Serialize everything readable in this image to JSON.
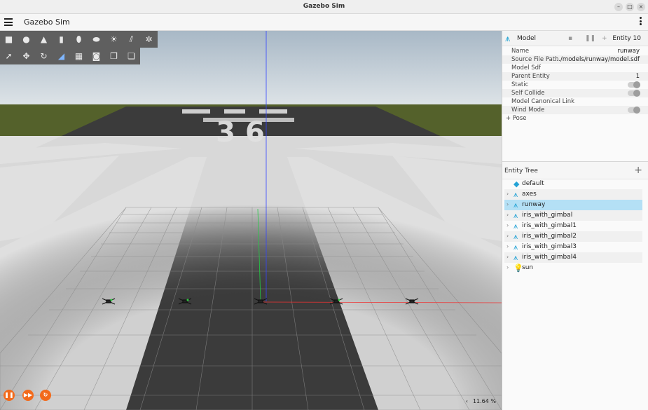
{
  "window": {
    "title": "Gazebo Sim"
  },
  "menubar": {
    "app_title": "Gazebo Sim"
  },
  "toolbar_shapes": [
    "box",
    "sphere",
    "cone",
    "cylinder",
    "capsule",
    "ellipsoid",
    "sun",
    "directional-light",
    "point-light"
  ],
  "toolbar_tools": [
    "select",
    "translate",
    "rotate",
    "snap",
    "screenshot-grid",
    "camera",
    "copy",
    "paste"
  ],
  "component_inspector": {
    "label": "Model",
    "entity": "Entity 10",
    "properties": [
      {
        "key": "Name",
        "value": "runway"
      },
      {
        "key": "Source File Path",
        "value": ".../models/runway/model.sdf"
      },
      {
        "key": "Model Sdf",
        "value": ""
      },
      {
        "key": "Parent Entity",
        "value": "1"
      },
      {
        "key": "Static",
        "toggle": true
      },
      {
        "key": "Self Collide",
        "toggle": true
      },
      {
        "key": "Model Canonical Link",
        "value": ""
      },
      {
        "key": "Wind Mode",
        "toggle": true
      }
    ],
    "pose_label": "Pose"
  },
  "entity_tree": {
    "label": "Entity Tree",
    "items": [
      {
        "name": "default",
        "icon": "world-cube-icon",
        "expandable": false,
        "selected": false
      },
      {
        "name": "axes",
        "icon": "model-icon",
        "expandable": true,
        "selected": false
      },
      {
        "name": "runway",
        "icon": "model-icon",
        "expandable": true,
        "selected": true
      },
      {
        "name": "iris_with_gimbal",
        "icon": "model-icon",
        "expandable": true,
        "selected": false
      },
      {
        "name": "iris_with_gimbal1",
        "icon": "model-icon",
        "expandable": true,
        "selected": false
      },
      {
        "name": "iris_with_gimbal2",
        "icon": "model-icon",
        "expandable": true,
        "selected": false
      },
      {
        "name": "iris_with_gimbal3",
        "icon": "model-icon",
        "expandable": true,
        "selected": false
      },
      {
        "name": "iris_with_gimbal4",
        "icon": "model-icon",
        "expandable": true,
        "selected": false
      },
      {
        "name": "sun",
        "icon": "light-icon",
        "expandable": true,
        "selected": false
      }
    ]
  },
  "scene": {
    "runway_number": "36",
    "real_time_factor": "11.64 %",
    "colors": {
      "sky": "#cfd8de",
      "grass": "#54612b",
      "tarmac": "#3d3d3d",
      "controls": "#f26a1b"
    }
  }
}
